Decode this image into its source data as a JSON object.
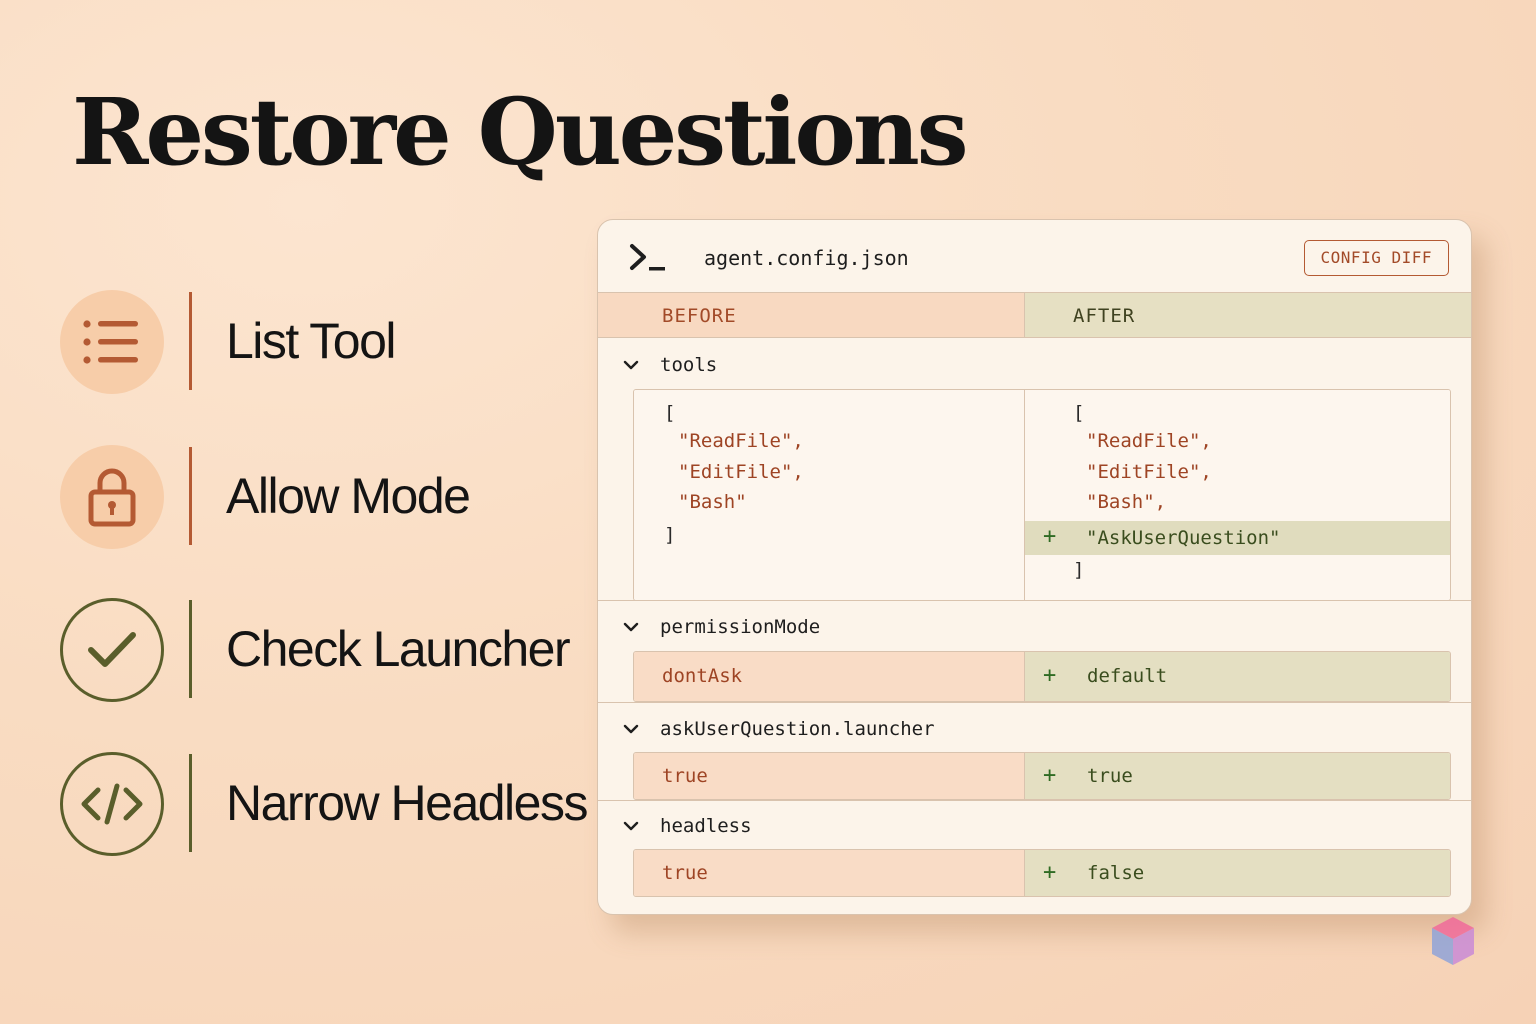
{
  "title": "Restore Questions",
  "steps": [
    {
      "label": "List Tool",
      "icon": "list-icon"
    },
    {
      "label": "Allow Mode",
      "icon": "lock-icon"
    },
    {
      "label": "Check Launcher",
      "icon": "check-icon"
    },
    {
      "label": "Narrow Headless",
      "icon": "code-icon"
    }
  ],
  "panel": {
    "filename": "agent.config.json",
    "badge": "CONFIG DIFF",
    "before_header": "BEFORE",
    "after_header": "AFTER",
    "sections": {
      "tools": {
        "key": "tools",
        "before": {
          "open": "[",
          "items": [
            "\"ReadFile\",",
            "\"EditFile\",",
            "\"Bash\""
          ],
          "close": "]"
        },
        "after": {
          "open": "[",
          "items": [
            "\"ReadFile\",",
            "\"EditFile\",",
            "\"Bash\","
          ],
          "added": "\"AskUserQuestion\"",
          "close": "]"
        }
      },
      "permissionMode": {
        "key": "permissionMode",
        "before": "dontAsk",
        "after": "default"
      },
      "launcher": {
        "key": "askUserQuestion.launcher",
        "before": "true",
        "after": "true"
      },
      "headless": {
        "key": "headless",
        "before": "true",
        "after": "false"
      }
    },
    "plus_sign": "+"
  },
  "colors": {
    "accent_rust": "#b45a33",
    "accent_olive": "#5a5e2b",
    "background": "#f9dcc2",
    "panel": "#fcf4ea"
  }
}
